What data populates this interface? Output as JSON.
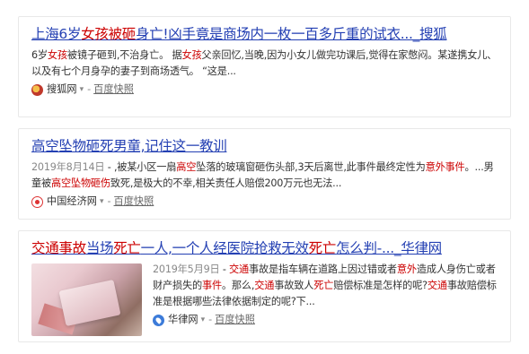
{
  "results": [
    {
      "title_pre": "上海6岁",
      "title_em1": "女孩被砸",
      "title_mid": "身亡!凶手竟是商场内一枚一百多斤重的试衣..._搜狐",
      "abs_1": "6岁",
      "abs_em1": "女孩",
      "abs_2": "被镜子砸到,不治身亡。 据",
      "abs_em2": "女孩",
      "abs_3": "父亲回忆,当晚,因为小女儿做完功课后,觉得在家憋闷。某遂携女儿、以及有七个月身孕的妻子到商场透气。 “这是...",
      "source": "搜狐网",
      "snapshot": "百度快照",
      "favicon_icon": "sohu-logo-icon"
    },
    {
      "title": "高空坠物砸死男童,记住这一教训",
      "date": "2019年8月14日",
      "abs_1": " - ,被某小区一扇",
      "abs_em1": "高空",
      "abs_2": "坠落的玻璃窗砸伤头部,3天后离世,此事件最终定性为",
      "abs_em2": "意外事件",
      "abs_3": "。...男童被",
      "abs_em3": "高空坠物砸伤",
      "abs_4": "致死,是极大的不幸,相关责任人赔偿200万元也无法...",
      "source": "中国经济网",
      "snapshot": "百度快照",
      "favicon_icon": "ce-logo-icon"
    },
    {
      "title_em1": "交通事故",
      "title_mid1": "当场",
      "title_em2": "死亡",
      "title_mid2": "一人,一个人经医院抢救无效",
      "title_em3": "死亡",
      "title_mid3": "怎么判-..._华律网",
      "date": "2019年5月9日",
      "abs_1": " - ",
      "abs_em1": "交通",
      "abs_2": "事故是指车辆在道路上因过错或者",
      "abs_em2": "意外",
      "abs_3": "造成人身伤亡或者财产损失的",
      "abs_em3": "事件",
      "abs_4": "。那么,",
      "abs_em4": "交通",
      "abs_5": "事故致人",
      "abs_em5": "死亡",
      "abs_6": "赔偿标准是怎样的呢?",
      "abs_em6": "交通",
      "abs_7": "事故赔偿标准是根据哪些法律依据制定的呢?下...",
      "source": "华律网",
      "snapshot": "百度快照",
      "favicon_icon": "hualv-logo-icon",
      "thumb_icon": "money-photo-thumbnail"
    }
  ],
  "ui": {
    "arrow": "▾",
    "dash": "-"
  }
}
